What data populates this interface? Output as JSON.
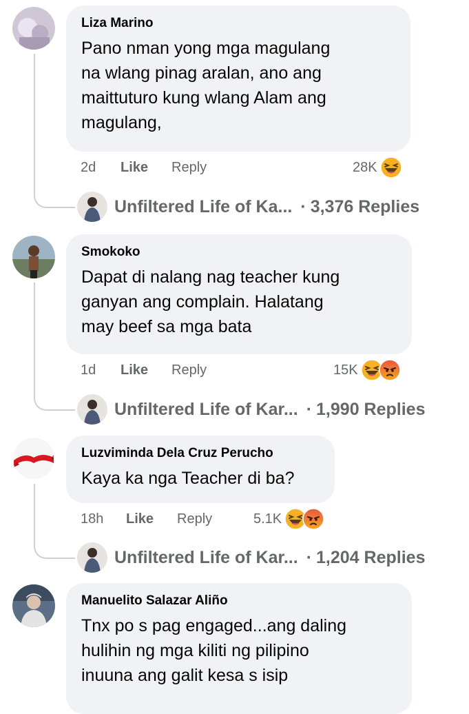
{
  "comments": [
    {
      "author": "Liza Marino",
      "lines": [
        "Pano nman yong mga magulang",
        "na wlang pinag aralan, ano ang",
        "maittuturo kung wlang Alam ang",
        "magulang,"
      ],
      "time": "2d",
      "like_label": "Like",
      "reply_label": "Reply",
      "reaction_count": "28K",
      "reactions": [
        "haha-icon"
      ],
      "reply_page": "Unfiltered Life of Ka...",
      "reply_sep": "·",
      "reply_count": "3,376 Replies"
    },
    {
      "author": "Smokoko",
      "lines": [
        "Dapat di nalang nag teacher kung",
        "ganyan ang complain. Halatang",
        "may beef sa mga bata"
      ],
      "time": "1d",
      "like_label": "Like",
      "reply_label": "Reply",
      "reaction_count": "15K",
      "reactions": [
        "haha-icon",
        "angry-icon"
      ],
      "reply_page": "Unfiltered Life of Kar...",
      "reply_sep": "·",
      "reply_count": "1,990 Replies"
    },
    {
      "author": "Luzviminda Dela Cruz Perucho",
      "lines": [
        "Kaya ka nga Teacher di ba?"
      ],
      "time": "18h",
      "like_label": "Like",
      "reply_label": "Reply",
      "reaction_count": "5.1K",
      "reactions": [
        "haha-icon",
        "angry-icon"
      ],
      "reply_page": "Unfiltered Life of Kar...",
      "reply_sep": "·",
      "reply_count": "1,204 Replies"
    },
    {
      "author": "Manuelito Salazar Aliño",
      "lines": [
        "Tnx po s pag engaged...ang daling",
        "hulihin ng mga kiliti ng pilipino",
        "inuuna ang galit kesa s isip"
      ]
    }
  ],
  "colors": {
    "bubble": "#f0f2f5",
    "meta_text": "#65676b",
    "thread_line": "#ced0d4"
  }
}
